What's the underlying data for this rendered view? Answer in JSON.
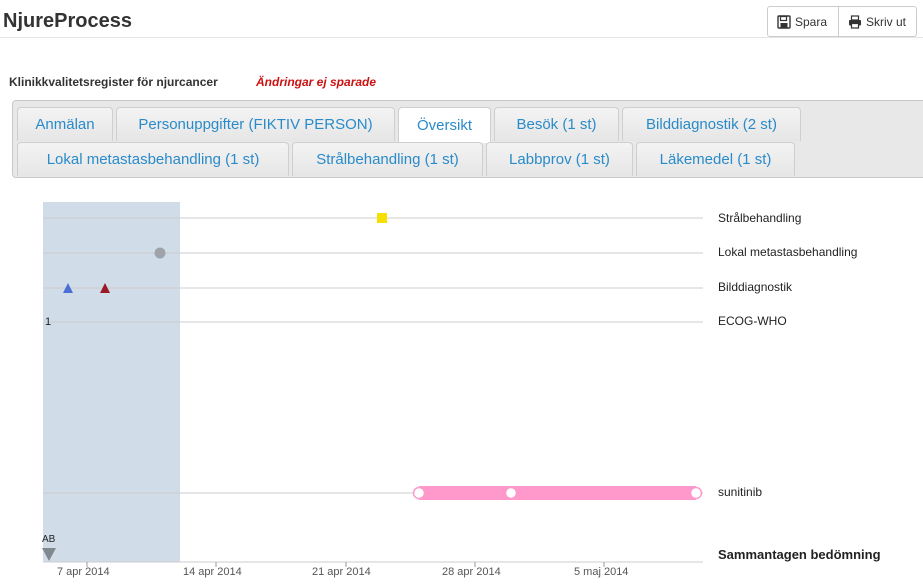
{
  "header": {
    "title": "NjureProcess",
    "save_label": "Spara",
    "print_label": "Skriv ut"
  },
  "register": {
    "title": "Klinikkvalitetsregister för njurcancer",
    "unsaved_notice": "Ändringar ej sparade"
  },
  "tabs": [
    {
      "label": "Anmälan"
    },
    {
      "label": "Personuppgifter (FIKTIV PERSON)"
    },
    {
      "label": "Översikt",
      "active": true
    },
    {
      "label": "Besök (1 st)"
    },
    {
      "label": "Bilddiagnostik (2 st)"
    },
    {
      "label": "Lokal metastasbehandling (1 st)"
    },
    {
      "label": "Strålbehandling (1 st)"
    },
    {
      "label": "Labbprov (1 st)"
    },
    {
      "label": "Läkemedel (1 st)"
    }
  ],
  "timeline": {
    "rows": [
      {
        "label": "Strålbehandling"
      },
      {
        "label": "Lokal metastasbehandling"
      },
      {
        "label": "Bilddiagnostik"
      },
      {
        "label": "ECOG-WHO"
      },
      {
        "label": "sunitinib"
      }
    ],
    "summary_label": "Sammantagen bedömning",
    "ecog_value": "1",
    "ab_label": "AB",
    "x_ticks": [
      "7 apr 2014",
      "14 apr 2014",
      "21 apr 2014",
      "28 apr 2014",
      "5 maj 2014"
    ],
    "colors": {
      "highlight_band": "#d0dce8",
      "stralbehandling": "#f5e000",
      "lokal_metastas": "#a0a4aa",
      "bilddiagnostik_1": "#4a6fd6",
      "bilddiagnostik_2": "#9a1a2a",
      "sunitinib": "#ff99cc"
    }
  }
}
